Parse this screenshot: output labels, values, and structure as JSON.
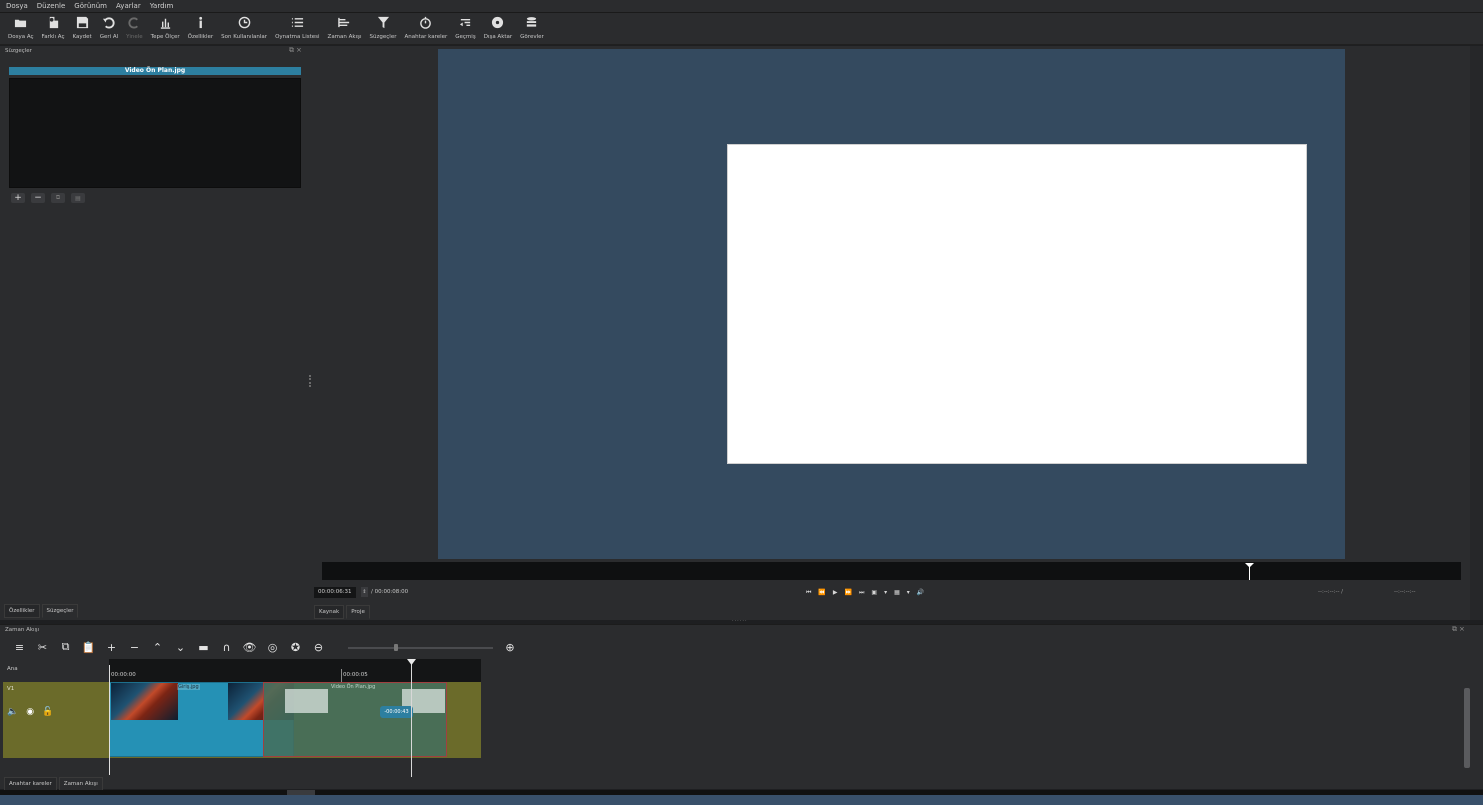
{
  "menu": [
    "Dosya",
    "Düzenle",
    "Görünüm",
    "Ayarlar",
    "Yardım"
  ],
  "toolbar": [
    {
      "label": "Dosya Aç",
      "icon": "open-folder-icon"
    },
    {
      "label": "Farklı Aç",
      "icon": "open-other-icon"
    },
    {
      "label": "Kaydet",
      "icon": "save-icon"
    },
    {
      "label": "Geri Al",
      "icon": "undo-icon"
    },
    {
      "label": "Yinele",
      "icon": "redo-icon"
    },
    {
      "label": "Tepe Ölçer",
      "icon": "peak-meter-icon"
    },
    {
      "label": "Özellikler",
      "icon": "info-icon"
    },
    {
      "label": "Son Kullanılanlar",
      "icon": "clock-icon"
    },
    {
      "label": "Oynatma Listesi",
      "icon": "list-icon"
    },
    {
      "label": "Zaman Akışı",
      "icon": "timeline-icon"
    },
    {
      "label": "Süzgeçler",
      "icon": "filter-icon"
    },
    {
      "label": "Anahtar kareler",
      "icon": "stopwatch-icon"
    },
    {
      "label": "Geçmiş",
      "icon": "history-icon"
    },
    {
      "label": "Dışa Aktar",
      "icon": "export-disc-icon"
    },
    {
      "label": "Görevler",
      "icon": "jobs-stack-icon"
    }
  ],
  "filters_panel": {
    "title": "Süzgeçler",
    "clip_name": "Video Ön Plan.jpg",
    "tabs": [
      "Özellikler",
      "Süzgeçler"
    ]
  },
  "player": {
    "timecode": "00:00:06:31",
    "total": "/ 00:00:08:00",
    "in_point": "--:--:--:-- /",
    "out_point": "--:--:--:--",
    "tabs": [
      "Kaynak",
      "Proje"
    ]
  },
  "timeline": {
    "title": "Zaman Akışı",
    "track_master": "Ana",
    "track_v1": "V1",
    "ruler": [
      "00:00:00",
      "00:00:05"
    ],
    "clip1_label": "Giriş.jpg",
    "clip2_label": "Video Ön Plan.jpg",
    "drag_offset": "-00:00:43",
    "tabs": [
      "Anahtar kareler",
      "Zaman Akışı"
    ]
  }
}
